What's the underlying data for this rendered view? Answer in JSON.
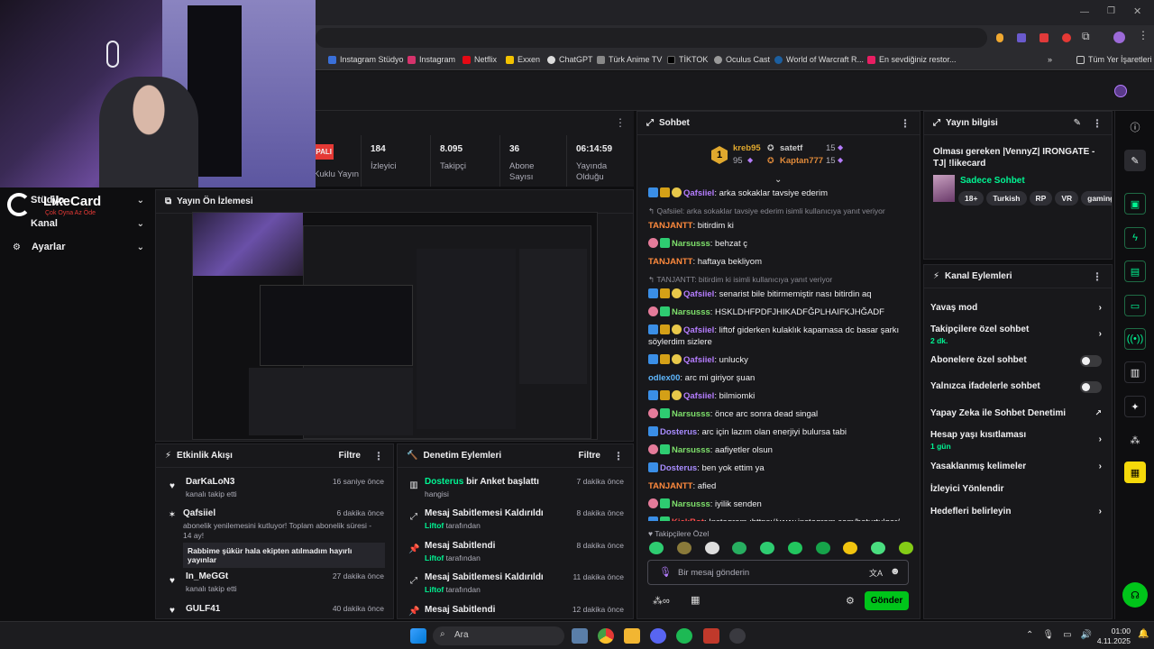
{
  "browser": {
    "bookmarks": [
      {
        "label": "Instagram Stüdyo",
        "color": "#3a6fd8"
      },
      {
        "label": "Instagram",
        "color": "#d6336c"
      },
      {
        "label": "Netflix",
        "color": "#e50914"
      },
      {
        "label": "Exxen",
        "color": "#f2c200"
      },
      {
        "label": "ChatGPT",
        "color": "#dddddd"
      },
      {
        "label": "Türk Anime TV",
        "color": "#888888"
      },
      {
        "label": "TİKTOK",
        "color": "#111111"
      },
      {
        "label": "Oculus Cast",
        "color": "#9a9a9a"
      },
      {
        "label": "World of Warcraft R...",
        "color": "#1c5fa0"
      },
      {
        "label": "En sevdiğiniz restor...",
        "color": "#e91e63"
      }
    ],
    "all_bookmarks": "Tüm Yer İşaretleri"
  },
  "webcam": {
    "brand": "LikeCard",
    "slogan": "Çok Oyna Az Öde"
  },
  "sidenav": {
    "items": [
      {
        "label": "Stüdyo"
      },
      {
        "label": "Kanal"
      },
      {
        "label": "Ayarlar"
      }
    ]
  },
  "live_badge": "ÇAPALI",
  "stats": [
    {
      "value": "",
      "label": "Kuklu Yayın"
    },
    {
      "value": "184",
      "label": "İzleyici"
    },
    {
      "value": "8.095",
      "label": "Takipçi"
    },
    {
      "value": "36",
      "label": "Abone Sayısı"
    },
    {
      "value": "06:14:59",
      "label": "Yayında Olduğu"
    }
  ],
  "preview": {
    "title": "Yayın Ön İzlemesi"
  },
  "activity": {
    "title": "Etkinlik Akışı",
    "filter": "Filtre",
    "items": [
      {
        "user": "DarKaLoN3",
        "sub": "kanalı takip etti",
        "time": "16 saniye önce",
        "icon": "heart-icon"
      },
      {
        "user": "Qafsiiel",
        "sub": "abonelik yenilemesini kutluyor! Toplam abonelik süresi - 14 ay!",
        "time": "6 dakika önce",
        "icon": "star-icon",
        "message": "Rabbime şükür hala ekipten atılmadım hayırlı yayınlar"
      },
      {
        "user": "In_MeGGt",
        "sub": "kanalı takip etti",
        "time": "27 dakika önce",
        "icon": "heart-icon"
      },
      {
        "user": "GULF41",
        "sub": "",
        "time": "40 dakika önce",
        "icon": "heart-icon"
      }
    ]
  },
  "mod": {
    "title": "Denetim Eylemleri",
    "filter": "Filtre",
    "items": [
      {
        "title_user": "Dosterus",
        "title_rest": " bir Anket başlattı",
        "sub": "hangisi",
        "by": "",
        "time": "7 dakika önce"
      },
      {
        "title_user": "",
        "title_rest": "Mesaj Sabitlemesi Kaldırıldı",
        "sub": " tarafından",
        "by": "Liftof",
        "time": "8 dakika önce"
      },
      {
        "title_user": "",
        "title_rest": "Mesaj Sabitlendi",
        "sub": " tarafından",
        "by": "Liftof",
        "time": "8 dakika önce"
      },
      {
        "title_user": "",
        "title_rest": "Mesaj Sabitlemesi Kaldırıldı",
        "sub": " tarafından",
        "by": "Liftof",
        "time": "11 dakika önce"
      },
      {
        "title_user": "",
        "title_rest": "Mesaj Sabitlendi",
        "sub": "",
        "by": "",
        "time": "12 dakika önce"
      }
    ]
  },
  "chat": {
    "title": "Sohbet",
    "leaderboard": [
      {
        "rank": "1",
        "name": "kreb95",
        "points": "95"
      },
      {
        "name": "satetf",
        "points": "15"
      },
      {
        "name": "Kaptan777",
        "points": "15"
      }
    ],
    "messages": [
      {
        "user": "Qafsiiel",
        "color": "#b57dff",
        "text": ": arka sokaklar tavsiye ederim",
        "badges": [
          "sub",
          "crown",
          "flower"
        ]
      },
      {
        "reply": "Qafsiiel: arka sokaklar tavsiye ederim isimli kullanıcıya yanıt veriyor"
      },
      {
        "user": "TANJANTT",
        "color": "#ff8a3d",
        "text": ": bitirdim ki",
        "badges": []
      },
      {
        "user": "Narsusss",
        "color": "#7ee06b",
        "text": ": behzat ç",
        "badges": [
          "pink",
          "green"
        ]
      },
      {
        "user": "TANJANTT",
        "color": "#ff8a3d",
        "text": ": haftaya bekliyom",
        "badges": []
      },
      {
        "reply": "TANJANTT: bitirdim ki isimli kullanıcıya yanıt veriyor"
      },
      {
        "user": "Qafsiiel",
        "color": "#b57dff",
        "text": ": senarist bile bitirmemiştir nası bitirdin aq",
        "badges": [
          "sub",
          "crown",
          "flower"
        ]
      },
      {
        "user": "Narsusss",
        "color": "#7ee06b",
        "text": ": HSKLDHFPDFJHIKADFĞPLHAIFKJHĞADF",
        "badges": [
          "pink",
          "green"
        ]
      },
      {
        "user": "Qafsiiel",
        "color": "#b57dff",
        "text": ": liftof giderken kulaklık kapamasa dc basar şarkı söylerdim sizlere",
        "badges": [
          "sub",
          "crown",
          "flower"
        ]
      },
      {
        "user": "Qafsiiel",
        "color": "#b57dff",
        "text": ": unlucky",
        "badges": [
          "sub",
          "crown",
          "flower"
        ]
      },
      {
        "user": "odlex00",
        "color": "#5fb8ff",
        "text": ": arc mi giriyor şuan",
        "badges": []
      },
      {
        "user": "Qafsiiel",
        "color": "#b57dff",
        "text": ": bilmiomki",
        "badges": [
          "sub",
          "crown",
          "flower"
        ]
      },
      {
        "user": "Narsusss",
        "color": "#7ee06b",
        "text": ": önce arc sonra dead singal",
        "badges": [
          "pink",
          "green"
        ]
      },
      {
        "user": "Dosterus",
        "color": "#a88cff",
        "text": ": arc için lazım olan enerjiyi bulursa tabi",
        "badges": [
          "sub"
        ]
      },
      {
        "user": "Narsusss",
        "color": "#7ee06b",
        "text": ": aafiyetler olsun",
        "badges": [
          "pink",
          "green"
        ]
      },
      {
        "user": "Dosterus",
        "color": "#a88cff",
        "text": ": ben yok ettim ya",
        "badges": [
          "sub"
        ]
      },
      {
        "user": "TANJANTT",
        "color": "#ff8a3d",
        "text": ": afied",
        "badges": []
      },
      {
        "user": "Narsusss",
        "color": "#7ee06b",
        "text": ": iyilik senden",
        "badges": [
          "pink",
          "green"
        ]
      },
      {
        "user": "KickBot",
        "color": "#ff4d4d",
        "text": ": Instagram :https://www.instagram.com/baturtulgar/",
        "badges": [
          "sub",
          "green"
        ]
      }
    ],
    "followers_only": "Takipçilere Özel",
    "input_placeholder": "Bir mesaj gönderin",
    "send": "Gönder"
  },
  "info": {
    "title": "Yayın bilgisi",
    "stream_title": "Olması gereken |VennyZ| IRONGATE - TJ| !likecard",
    "category": "Sadece Sohbet",
    "tags": [
      "18+",
      "Turkish",
      "RP",
      "VR",
      "gaming"
    ]
  },
  "actions": {
    "title": "Kanal Eylemleri",
    "items": [
      {
        "label": "Yavaş mod",
        "sub": "",
        "control": "chev"
      },
      {
        "label": "Takipçilere özel sohbet",
        "sub": "2 dk.",
        "control": "chev"
      },
      {
        "label": "Abonelere özel sohbet",
        "sub": "",
        "control": "toggle"
      },
      {
        "label": "Yalnızca ifadelerle sohbet",
        "sub": "",
        "control": "toggle"
      },
      {
        "label": "Yapay Zeka ile Sohbet Denetimi",
        "sub": "",
        "control": "ext"
      },
      {
        "label": "Hesap yaşı kısıtlaması",
        "sub": "1 gün",
        "control": "chev"
      },
      {
        "label": "Yasaklanmış kelimeler",
        "sub": "",
        "control": "chev"
      },
      {
        "label": "İzleyici Yönlendir",
        "sub": "",
        "control": "none"
      },
      {
        "label": "Hedefleri belirleyin",
        "sub": "",
        "control": "chev"
      }
    ]
  },
  "taskbar": {
    "search": "Ara",
    "time": "01:00",
    "date": "4.11.2025"
  },
  "colors": {
    "accent": "#00f593",
    "send": "#00c41a",
    "panel": "#18181b",
    "bg": "#0e0e10"
  }
}
